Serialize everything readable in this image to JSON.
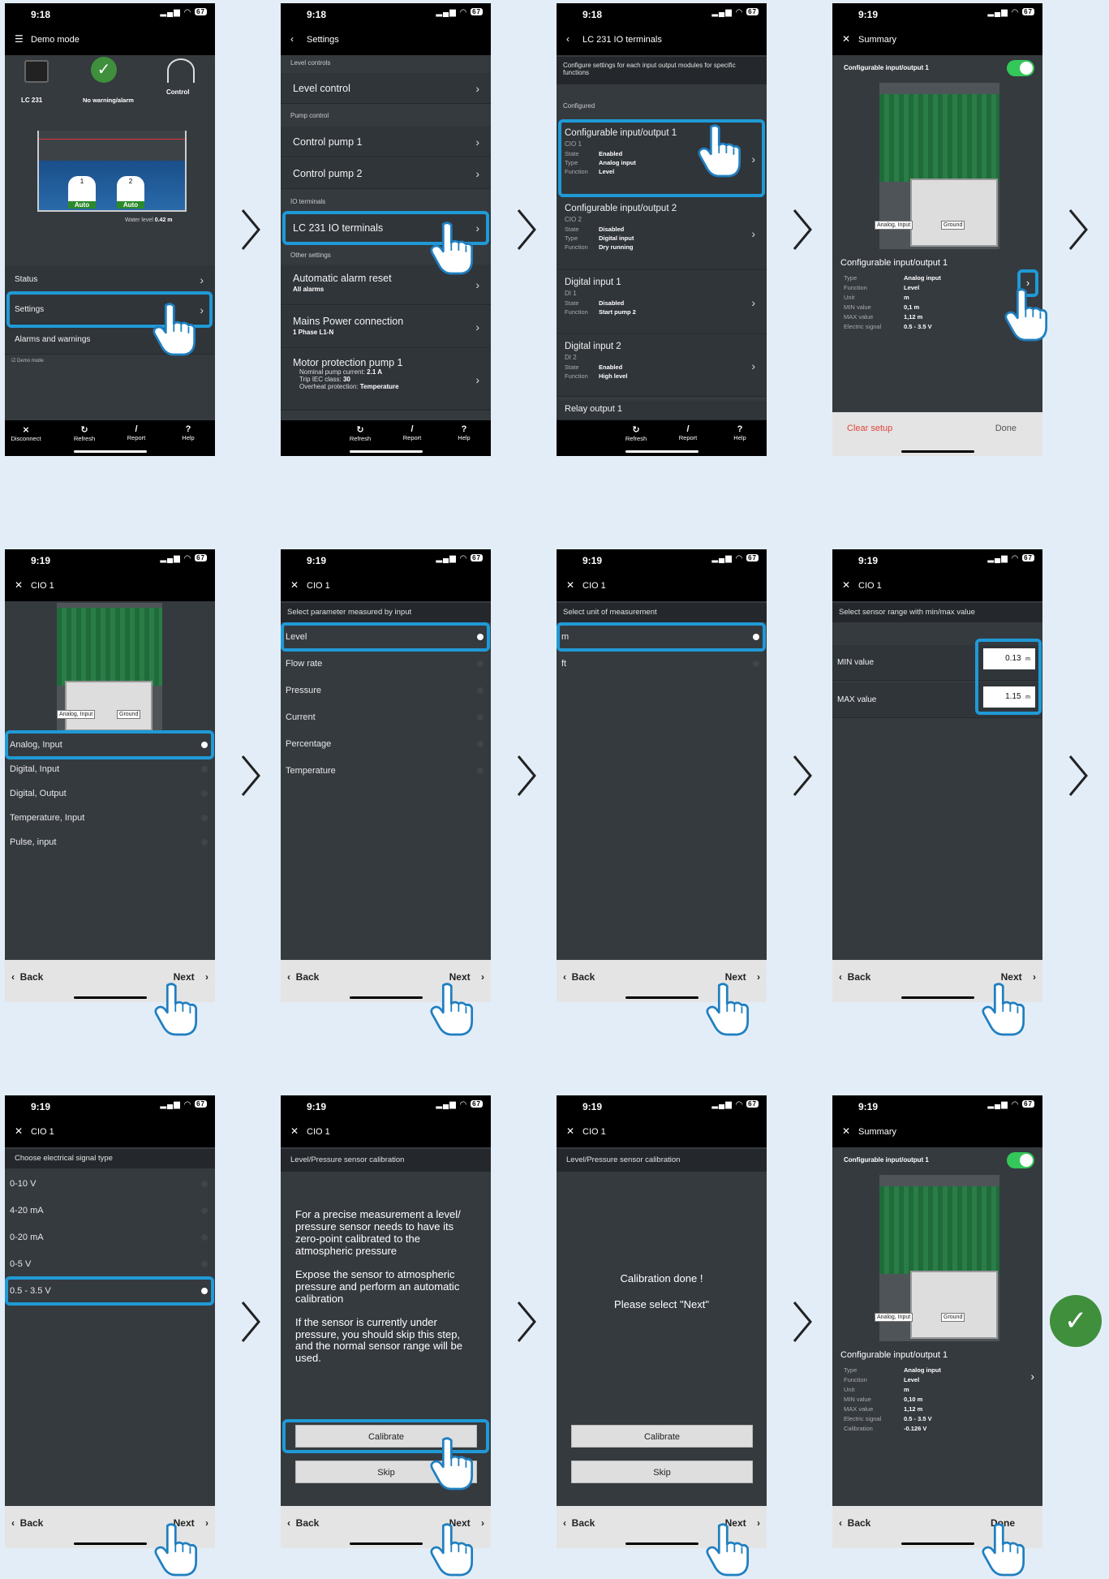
{
  "s1": {
    "time": "9:18",
    "battery": "67",
    "header": "Demo mode",
    "device": "LC 231",
    "warn": "No warning/alarm",
    "control": "Control",
    "tank": {
      "pump1": "1",
      "pump2": "2",
      "auto": "Auto"
    },
    "water_level": "Water level",
    "water_value": "0.42 m",
    "menu": [
      "Status",
      "Settings",
      "Alarms and warnings"
    ],
    "demo": "Demo mode",
    "tabs": [
      "Disconnect",
      "Refresh",
      "Report",
      "Help"
    ]
  },
  "s2": {
    "time": "9:18",
    "battery": "67",
    "header": "Settings",
    "sec_level": "Level controls",
    "level_control": "Level control",
    "sec_pump": "Pump control",
    "cp1": "Control pump 1",
    "cp2": "Control pump 2",
    "sec_io": "IO terminals",
    "io": "LC 231 IO terminals",
    "sec_other": "Other settings",
    "alarm_reset": "Automatic alarm reset",
    "alarm_reset_sub": "All alarms",
    "mains": "Mains Power connection",
    "mains_sub": "1 Phase L1-N",
    "motor": "Motor protection pump 1",
    "motor_l1": "Nominal pump current:",
    "motor_v1": "2.1 A",
    "motor_l2": "Trip IEC class:",
    "motor_v2": "30",
    "motor_l3": "Overheat protection:",
    "motor_v3": "Temperature",
    "tabs": [
      "Refresh",
      "Report",
      "Help"
    ]
  },
  "s3": {
    "time": "9:18",
    "battery": "67",
    "header": "LC 231 IO terminals",
    "desc": "Configure settings for each input output modules for specific functions",
    "configured": "Configured",
    "items": [
      {
        "title": "Configurable input/output 1",
        "id": "CIO 1",
        "l1": "State",
        "v1": "Enabled",
        "l2": "Type",
        "v2": "Analog input",
        "l3": "Function",
        "v3": "Level"
      },
      {
        "title": "Configurable input/output 2",
        "id": "CIO 2",
        "l1": "State",
        "v1": "Disabled",
        "l2": "Type",
        "v2": "Digital input",
        "l3": "Function",
        "v3": "Dry running"
      },
      {
        "title": "Digital input 1",
        "id": "DI 1",
        "l1": "State",
        "v1": "Disabled",
        "l2": "Function",
        "v2": "Start pump 2"
      },
      {
        "title": "Digital input 2",
        "id": "DI 2",
        "l1": "State",
        "v1": "Enabled",
        "l2": "Function",
        "v2": "High level"
      }
    ],
    "relay": "Relay output 1",
    "tabs": [
      "Refresh",
      "Report",
      "Help"
    ]
  },
  "s4": {
    "time": "9:19",
    "battery": "67",
    "header": "Summary",
    "title": "Configurable input/output 1",
    "analog": "Analog, Input",
    "ground": "Ground",
    "section": "Configurable input/output 1",
    "kv": [
      [
        "Type",
        "Analog input"
      ],
      [
        "Function",
        "Level"
      ],
      [
        "Unit",
        "m"
      ],
      [
        "MIN value",
        "0,1 m"
      ],
      [
        "MAX value",
        "1,12 m"
      ],
      [
        "Electric signal",
        "0.5 - 3.5 V"
      ]
    ],
    "clear": "Clear setup",
    "done": "Done"
  },
  "s5": {
    "time": "9:19",
    "battery": "67",
    "header": "CIO 1",
    "analog": "Analog, Input",
    "ground": "Ground",
    "options": [
      "Analog, Input",
      "Digital, Input",
      "Digital, Output",
      "Temperature, Input",
      "Pulse, input"
    ],
    "back": "Back",
    "next": "Next"
  },
  "s6": {
    "time": "9:19",
    "battery": "67",
    "header": "CIO 1",
    "prompt": "Select parameter measured by input",
    "options": [
      "Level",
      "Flow rate",
      "Pressure",
      "Current",
      "Percentage",
      "Temperature"
    ],
    "back": "Back",
    "next": "Next"
  },
  "s7": {
    "time": "9:19",
    "battery": "67",
    "header": "CIO 1",
    "prompt": "Select unit of measurement",
    "options": [
      "m",
      "ft"
    ],
    "back": "Back",
    "next": "Next"
  },
  "s8": {
    "time": "9:19",
    "battery": "67",
    "header": "CIO 1",
    "prompt": "Select sensor range with min/max value",
    "min_label": "MIN value",
    "min_val": "0.13",
    "max_label": "MAX value",
    "max_val": "1.15",
    "unit": "m",
    "back": "Back",
    "next": "Next"
  },
  "s9": {
    "time": "9:19",
    "battery": "67",
    "header": "CIO 1",
    "prompt": "Choose electrical signal type",
    "options": [
      "0-10 V",
      "4-20 mA",
      "0-20 mA",
      "0-5 V",
      "0.5 - 3.5 V"
    ],
    "back": "Back",
    "next": "Next"
  },
  "s10": {
    "time": "9:19",
    "battery": "67",
    "header": "CIO 1",
    "prompt": "Level/Pressure sensor calibration",
    "p1": "For a precise measurement a level/ pressure sensor needs to have its zero-point calibrated to the atmospheric pressure",
    "p2": "Expose the sensor to atmospheric pressure and perform an automatic calibration",
    "p3": "If the sensor is currently under pressure, you should skip this step, and the normal sensor range will be used.",
    "calibrate": "Calibrate",
    "skip": "Skip",
    "back": "Back",
    "next": "Next"
  },
  "s11": {
    "time": "9:19",
    "battery": "67",
    "header": "CIO 1",
    "prompt": "Level/Pressure sensor calibration",
    "done1": "Calibration done !",
    "done2": "Please select \"Next\"",
    "calibrate": "Calibrate",
    "skip": "Skip",
    "back": "Back",
    "next": "Next"
  },
  "s12": {
    "time": "9:19",
    "battery": "67",
    "header": "Summary",
    "title": "Configurable input/output 1",
    "analog": "Analog, Input",
    "ground": "Ground",
    "section": "Configurable input/output 1",
    "kv": [
      [
        "Type",
        "Analog input"
      ],
      [
        "Function",
        "Level"
      ],
      [
        "Unit",
        "m"
      ],
      [
        "MIN value",
        "0,10 m"
      ],
      [
        "MAX value",
        "1,12 m"
      ],
      [
        "Electric signal",
        "0.5 - 3.5 V"
      ],
      [
        "Calibration",
        "-0.126 V"
      ]
    ],
    "back": "Back",
    "done": "Done"
  },
  "colors": {
    "background": "#e3edf8",
    "highlight": "#1f9ad6",
    "screen": "#353a3f",
    "success": "#3f8f3c",
    "toggle": "#34c759",
    "danger": "#e0453a"
  }
}
